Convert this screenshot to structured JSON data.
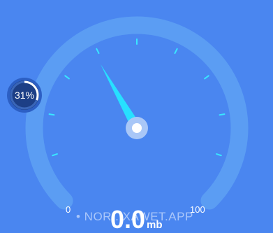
{
  "gauge": {
    "scale_min_label": "0",
    "scale_max_label": "100",
    "needle_fraction": 0.39,
    "colors": {
      "background": "#4a86f0",
      "arc_track": "#5b9df3",
      "tick": "#39e6ff",
      "needle": "#27e0ff",
      "hub_ring": "#a9c7f7",
      "hub_center": "#ffffff"
    }
  },
  "readout": {
    "value": "0.0",
    "unit": "mb"
  },
  "progress_badge": {
    "percent_label": "31%",
    "fraction": 0.31,
    "ring_color": "#ffffff",
    "badge_color": "#1d3f86"
  },
  "watermark": {
    "text": "• NOR...XAWET.APP"
  }
}
